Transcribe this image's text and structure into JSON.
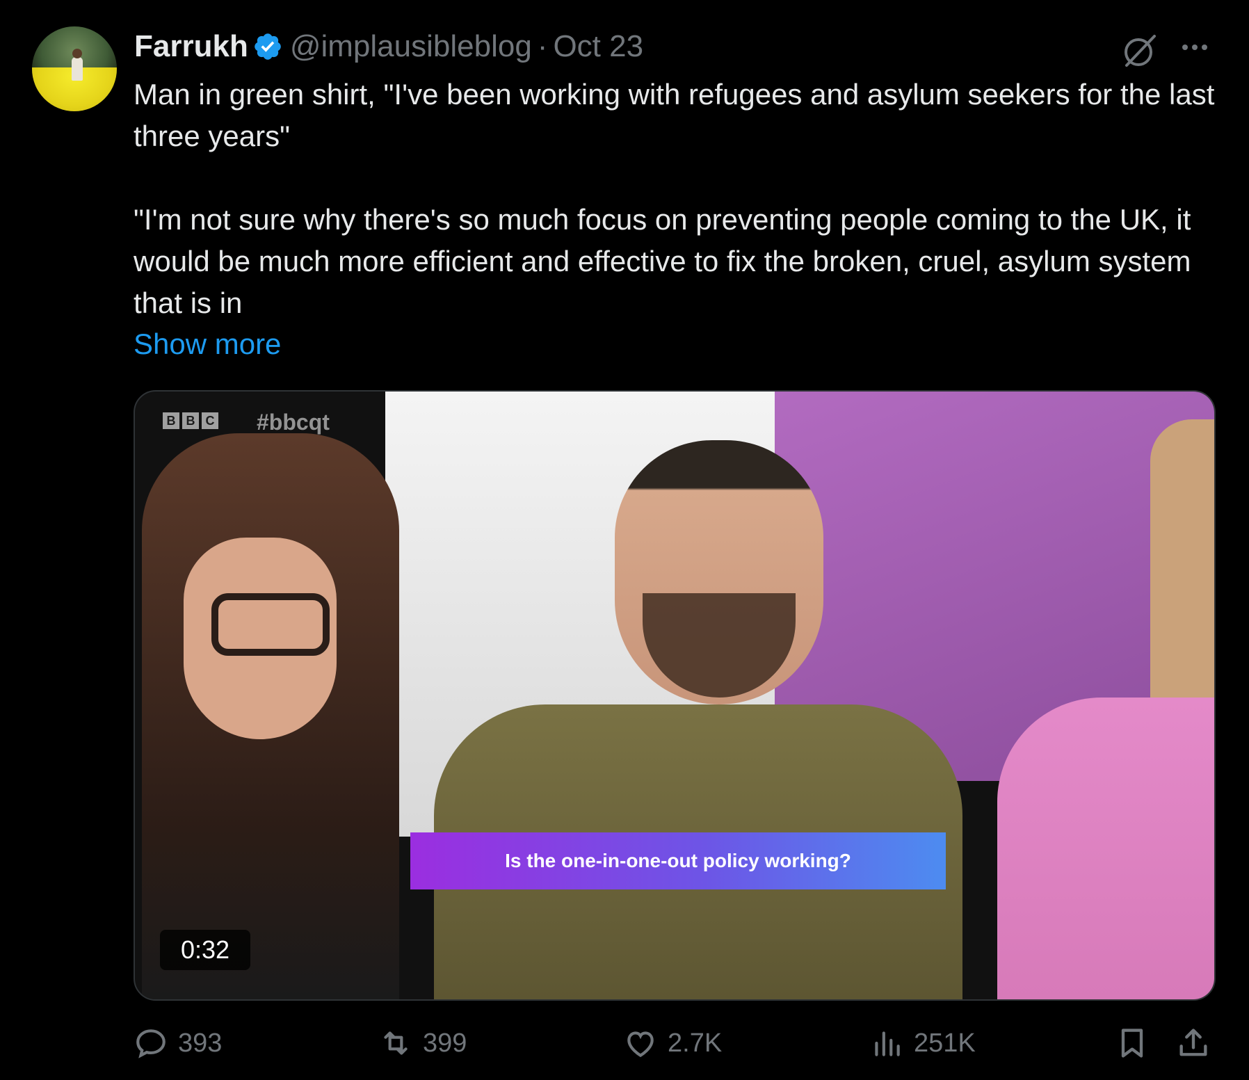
{
  "author": {
    "name": "Farrukh",
    "handle": "@implausibleblog",
    "separator": "·",
    "date": "Oct 23",
    "verified": true,
    "verified_color": "#1d9bf0"
  },
  "tweet": {
    "paragraph1": "Man in green shirt, \"I've been working with refugees and asylum seekers for the last three years\"",
    "paragraph2": "\"I'm not sure why there's so much focus on preventing people coming to the UK, it would be much more efficient and effective to fix the broken, cruel, asylum system that is in",
    "show_more": "Show more"
  },
  "video": {
    "logo_letters": [
      "B",
      "B",
      "C"
    ],
    "hashtag": "#bbcqt",
    "caption": "Is the one-in-one-out policy working?",
    "duration": "0:32"
  },
  "actions": {
    "replies": "393",
    "reposts": "399",
    "likes": "2.7K",
    "views": "251K"
  },
  "icons": {
    "grok": "grok-icon",
    "more": "more-icon",
    "reply": "reply-icon",
    "repost": "repost-icon",
    "like": "heart-icon",
    "views": "views-icon",
    "bookmark": "bookmark-icon",
    "share": "share-icon"
  },
  "colors": {
    "background": "#000000",
    "text": "#e7e9ea",
    "muted": "#71767b",
    "link": "#1d9bf0"
  }
}
